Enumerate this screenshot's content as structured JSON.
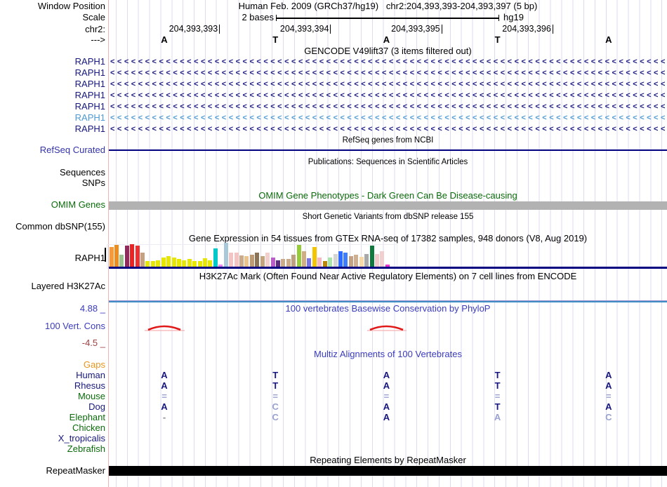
{
  "window_title": "UCSC Genome Browser view",
  "header": {
    "gutter": {
      "window_position": "Window Position",
      "scale": "Scale",
      "chromosome": "chr2:",
      "direction": "--->"
    },
    "assembly_line": "Human Feb. 2009 (GRCh37/hg19)   chr2:204,393,393-204,393,397 (5 bp)",
    "scale_label": "2 bases",
    "assembly_short": "hg19",
    "coordinates": [
      "204,393,393",
      "204,393,394",
      "204,393,395",
      "204,393,396"
    ],
    "bases": [
      "A",
      "T",
      "A",
      "T",
      "A"
    ]
  },
  "tracks": {
    "gencode": {
      "title": "GENCODE V49lift37 (3 items filtered out)",
      "transcripts": [
        {
          "label": "RAPH1",
          "shade": "dark"
        },
        {
          "label": "RAPH1",
          "shade": "dark"
        },
        {
          "label": "RAPH1",
          "shade": "dark"
        },
        {
          "label": "RAPH1",
          "shade": "dark"
        },
        {
          "label": "RAPH1",
          "shade": "dark"
        },
        {
          "label": "RAPH1",
          "shade": "light"
        },
        {
          "label": "RAPH1",
          "shade": "dark"
        }
      ],
      "strand_glyph": "<"
    },
    "refseq": {
      "subtitle": "RefSeq genes from NCBI",
      "label": "RefSeq Curated"
    },
    "publications": {
      "subtitle": "Publications: Sequences in Scientific Articles",
      "labels": [
        "Sequences",
        "SNPs"
      ]
    },
    "omim": {
      "title": "OMIM Gene Phenotypes - Dark Green Can Be Disease-causing",
      "label": "OMIM Genes"
    },
    "dbsnp": {
      "subtitle": "Short Genetic Variants from dbSNP release 155",
      "label": "Common dbSNP(155)"
    },
    "gtex": {
      "title": "Gene Expression in 54 tissues from GTEx RNA-seq of 17382 samples, 948 donors (V8, Aug 2019)",
      "label": "RAPH1"
    },
    "h3k27ac": {
      "title": "H3K27Ac Mark (Often Found Near Active Regulatory Elements) on 7 cell lines from ENCODE",
      "label": "Layered H3K27Ac"
    },
    "phylop": {
      "title": "100 vertebrates Basewise Conservation by PhyloP",
      "label": "100 Vert. Cons",
      "max_label": "4.88 _",
      "min_label": "-4.5 _"
    },
    "multiz": {
      "title": "Multiz Alignments of 100 Vertebrates",
      "rows": [
        {
          "name": "Gaps",
          "color": "orange",
          "letters": [
            "",
            "",
            "",
            "",
            ""
          ],
          "styles": [
            "",
            "",
            "",
            "",
            ""
          ]
        },
        {
          "name": "Human",
          "color": "navy",
          "letters": [
            "A",
            "T",
            "A",
            "T",
            "A"
          ],
          "styles": [
            "dark",
            "dark",
            "dark",
            "dark",
            "dark"
          ]
        },
        {
          "name": "Rhesus",
          "color": "navy",
          "letters": [
            "A",
            "T",
            "A",
            "T",
            "A"
          ],
          "styles": [
            "dark",
            "dark",
            "dark",
            "dark",
            "dark"
          ]
        },
        {
          "name": "Mouse",
          "color": "green",
          "letters": [
            "=",
            "=",
            "=",
            "=",
            "="
          ],
          "styles": [
            "light",
            "light",
            "light",
            "light",
            "light"
          ]
        },
        {
          "name": "Dog",
          "color": "navy",
          "letters": [
            "A",
            "C",
            "A",
            "T",
            "A"
          ],
          "styles": [
            "dark",
            "light",
            "dark",
            "dark",
            "dark"
          ]
        },
        {
          "name": "Elephant",
          "color": "green",
          "letters": [
            "-",
            "C",
            "A",
            "A",
            "C"
          ],
          "styles": [
            "gray",
            "light",
            "dark",
            "light",
            "light"
          ]
        },
        {
          "name": "Chicken",
          "color": "green",
          "letters": [
            "",
            "",
            "",
            "",
            ""
          ],
          "styles": [
            "",
            "",
            "",
            "",
            ""
          ]
        },
        {
          "name": "X_tropicalis",
          "color": "navy",
          "letters": [
            "",
            "",
            "",
            "",
            ""
          ],
          "styles": [
            "",
            "",
            "",
            "",
            ""
          ]
        },
        {
          "name": "Zebrafish",
          "color": "green",
          "letters": [
            "",
            "",
            "",
            "",
            ""
          ],
          "styles": [
            "",
            "",
            "",
            "",
            ""
          ]
        }
      ]
    },
    "repeatmasker": {
      "title": "Repeating Elements by RepeatMasker",
      "label": "RepeatMasker"
    }
  },
  "chart_data": [
    {
      "type": "bar",
      "title": "Gene Expression in 54 tissues from GTEx RNA-seq of 17382 samples, 948 donors (V8, Aug 2019)",
      "gene": "RAPH1",
      "note": "54 tissue bars, tissue names not visible at this zoom; values are bar heights in screen px (max bar = 34)",
      "values": [
        28,
        31,
        17,
        30,
        32,
        30,
        20,
        8,
        8,
        9,
        13,
        15,
        13,
        11,
        9,
        11,
        8,
        8,
        12,
        9,
        26,
        3,
        34,
        20,
        20,
        16,
        15,
        17,
        20,
        15,
        20,
        13,
        9,
        11,
        11,
        17,
        31,
        22,
        12,
        28,
        13,
        8,
        13,
        18,
        22,
        20,
        15,
        17,
        14,
        18,
        30,
        18,
        22,
        3
      ],
      "colors": [
        "#f59a3d",
        "#ef8c1e",
        "#9bbf8f",
        "#8e2a5c",
        "#ee2222",
        "#f03030",
        "#c4a183",
        "#e6e600",
        "#e6e600",
        "#e6e600",
        "#e6e600",
        "#e6e600",
        "#e6e600",
        "#e6e600",
        "#e6e600",
        "#e6e600",
        "#e6e600",
        "#e6e600",
        "#e6e600",
        "#e6e600",
        "#00c8c8",
        "#ee82ee",
        "#a7c9da",
        "#f2c4c4",
        "#f2c4c4",
        "#cbab89",
        "#e9c48e",
        "#bc9a74",
        "#8b7355",
        "#c4a47c",
        "#f2cfcf",
        "#b860c8",
        "#5c2d80",
        "#c9ab8b",
        "#c9ab8b",
        "#bfa07e",
        "#96cc3a",
        "#cfae85",
        "#7b74e4",
        "#f5c400",
        "#f6b8c0",
        "#b8860b",
        "#a8e6a8",
        "#d4d4d4",
        "#2f6bff",
        "#3f7dff",
        "#c4a183",
        "#cdb091",
        "#f5d9a8",
        "#a8a8a8",
        "#0f7a3d",
        "#eecaca",
        "#f2cfcf",
        "#f030d0"
      ]
    },
    {
      "type": "line",
      "title": "100 vertebrates Basewise Conservation by PhyloP",
      "ylim": [
        -4.5,
        4.88
      ],
      "note": "two small red conservation peaks over bases 1 (A) and 3 (A)",
      "peaks": [
        {
          "base_index": 0,
          "base": "A"
        },
        {
          "base_index": 2,
          "base": "A"
        }
      ]
    }
  ],
  "colors": {
    "navy": "#17177f",
    "light_blue_transcript": "#4f9ad2",
    "green_label": "#0b6b0b",
    "blue_title": "#3b3bbe",
    "maroon": "#a04040",
    "orange": "#e8951e",
    "letter_light": "#9aa2d0",
    "letter_gray": "#8a8a9a",
    "gridline": "#dcdcf0",
    "left_edge_pink": "#f5b4b4",
    "refseq_line": "#000080",
    "gtex_baseline": "#000080",
    "h3k27ac_line": "#3f8fc4",
    "omim_bar_gray": "#b2b2b2",
    "repeat_bar_black": "#000000",
    "conservation_red": "#e01818"
  }
}
